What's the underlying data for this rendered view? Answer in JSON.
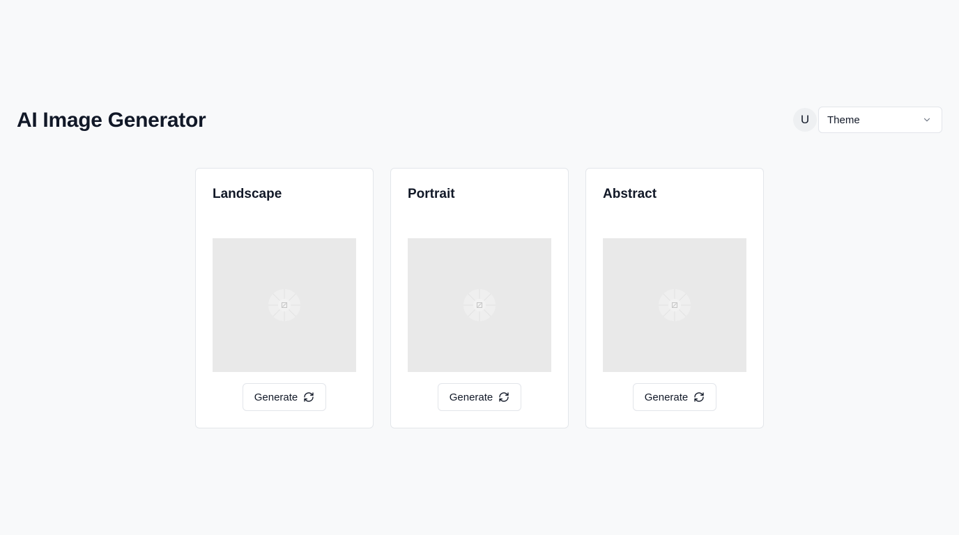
{
  "header": {
    "title": "AI Image Generator",
    "avatar_initial": "U",
    "theme_select": {
      "selected": "Theme",
      "icon": "chevron-down-icon"
    }
  },
  "cards": [
    {
      "title": "Landscape",
      "button_label": "Generate",
      "button_icon": "refresh-icon"
    },
    {
      "title": "Portrait",
      "button_label": "Generate",
      "button_icon": "refresh-icon"
    },
    {
      "title": "Abstract",
      "button_label": "Generate",
      "button_icon": "refresh-icon"
    }
  ],
  "colors": {
    "background": "#f8f9fa",
    "card_border": "#e3e6ea",
    "placeholder": "#e9e9e9",
    "text": "#111827"
  }
}
